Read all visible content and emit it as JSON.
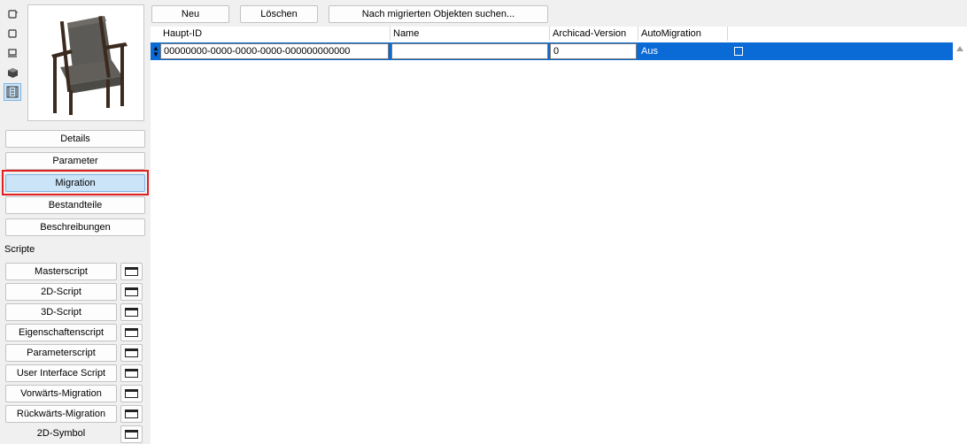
{
  "view_icons": [
    "2d-view-icon",
    "floor-plan-icon",
    "elevation-icon",
    "3d-cube-icon",
    "list-view-icon"
  ],
  "left_nav": {
    "details": "Details",
    "parameter": "Parameter",
    "migration": "Migration",
    "bestandteile": "Bestandteile",
    "beschreibungen": "Beschreibungen"
  },
  "scripts_label": "Scripte",
  "scripts": [
    "Masterscript",
    "2D-Script",
    "3D-Script",
    "Eigenschaftenscript",
    "Parameterscript",
    "User Interface Script",
    "Vorwärts-Migration",
    "Rückwärts-Migration",
    "2D-Symbol"
  ],
  "toolbar": {
    "new_label": "Neu",
    "delete_label": "Löschen",
    "search_label": "Nach migrierten Objekten suchen..."
  },
  "table": {
    "headers": [
      "Haupt-ID",
      "Name",
      "Archicad-Version",
      "AutoMigration"
    ],
    "rows": [
      {
        "haupt_id": "00000000-0000-0000-0000-000000000000",
        "name": "",
        "version": "0",
        "auto": "Aus"
      }
    ]
  },
  "colors": {
    "selection": "#0a6ad6",
    "highlight": "#e02020",
    "selected_button": "#cce4f7"
  }
}
